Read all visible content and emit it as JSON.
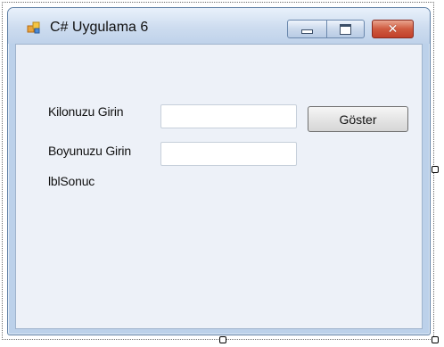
{
  "window": {
    "title": "C# Uygulama 6",
    "icon": "form-app-icon",
    "buttons": {
      "minimize": "minimize-icon",
      "maximize": "maximize-icon",
      "close_glyph": "✕"
    }
  },
  "form": {
    "weight_label": "Kilonuzu Girin",
    "weight_value": "",
    "height_label": "Boyunuzu Girin",
    "height_value": "",
    "show_button": "Göster",
    "result_label": "lblSonuc"
  },
  "colors": {
    "client_background": "#edf1f8",
    "close_button": "#c1402a"
  }
}
